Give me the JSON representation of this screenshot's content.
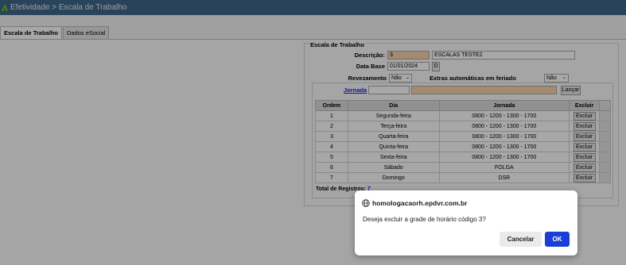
{
  "header": {
    "title": "Efetividade > Escala de Trabalho",
    "icon": "app-leaf-icon"
  },
  "tabs": [
    {
      "label": "Escala de Trabalho"
    },
    {
      "label": "Dados eSocial"
    }
  ],
  "form": {
    "legend": "Escala de Trabalho",
    "descricao_label": "Descrição:",
    "descricao_code": "3",
    "descricao_value": "ESCALAS TESTE2",
    "database_label": "Data Base",
    "database_value": "01/01/2024",
    "database_button": "D",
    "revezamento_label": "Revezamento",
    "revezamento_value": "Não",
    "extras_label": "Extras automáticas em feriado",
    "extras_value": "Não",
    "jornada_link": "Jornada",
    "jornada_code": "",
    "jornada_desc": "",
    "lancar_button": "Lançar"
  },
  "table": {
    "headers": [
      "Ordem",
      "Dia",
      "Jornada",
      "Excluir"
    ],
    "rows": [
      [
        "1",
        "Segunda-feira",
        "0800 - 1200 - 1300 - 1700",
        "Excluir"
      ],
      [
        "2",
        "Terça-feira",
        "0800 - 1200 - 1300 - 1700",
        "Excluir"
      ],
      [
        "3",
        "Quarta-feira",
        "0800 - 1200 - 1300 - 1700",
        "Excluir"
      ],
      [
        "4",
        "Quinta-feira",
        "0800 - 1200 - 1300 - 1700",
        "Excluir"
      ],
      [
        "5",
        "Sexta-feira",
        "0800 - 1200 - 1300 - 1700",
        "Excluir"
      ],
      [
        "6",
        "Sábado",
        "FOLGA",
        "Excluir"
      ],
      [
        "7",
        "Domingo",
        "DSR",
        "Excluir"
      ]
    ],
    "total_label": "Total de Registros:",
    "total_value": "7"
  },
  "dialog": {
    "host": "homologacaorh.epdvr.com.br",
    "message": "Deseja excluir a grade de horário código 3?",
    "cancel": "Cancelar",
    "ok": "OK"
  },
  "colors": {
    "titlebar": "#3f6889",
    "ok_button": "#1b3fd6",
    "link": "#2222cc",
    "highlight_input": "#f7d2aa"
  }
}
